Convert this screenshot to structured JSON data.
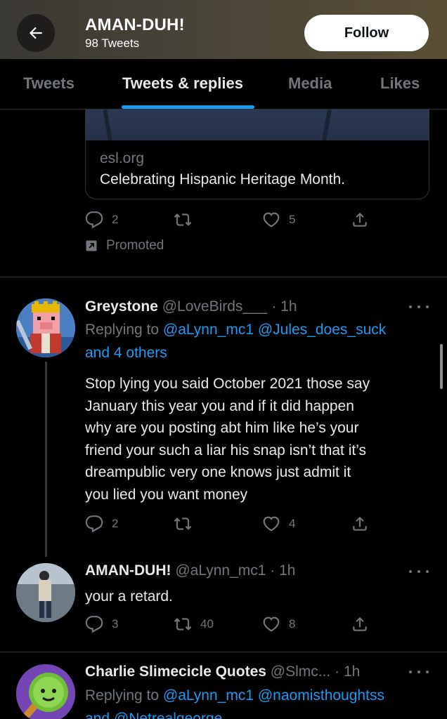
{
  "header": {
    "name": "AMAN-DUH!",
    "tweet_count": "98 Tweets",
    "follow_label": "Follow"
  },
  "tabs": [
    {
      "label": "Tweets",
      "active": false
    },
    {
      "label": "Tweets & replies",
      "active": true
    },
    {
      "label": "Media",
      "active": false
    },
    {
      "label": "Likes",
      "active": false
    }
  ],
  "promoted_card": {
    "domain": "esl.org",
    "title": "Celebrating Hispanic Heritage Month.",
    "replies": "2",
    "likes": "5",
    "promoted_label": "Promoted"
  },
  "tweets": [
    {
      "name": "Greystone",
      "handle": "@LoveBirds___",
      "time": "· 1h",
      "replying_prefix": "Replying to",
      "replying_to_1": "@aLynn_mc1",
      "replying_to_2": "@Jules_does_suck",
      "replying_to_3": "and 4 others",
      "text_lines": [
        "Stop lying you said October 2021 those say",
        "January this year you and if it did happen",
        "why are you posting abt him like he’s your",
        "friend your such a liar his snap isn’t that it’s",
        "dreampublic very one knows just admit it",
        "you lied you want money"
      ],
      "replies": "2",
      "retweets": "",
      "likes": "4"
    },
    {
      "name": "AMAN-DUH!",
      "handle": "@aLynn_mc1",
      "time": "· 1h",
      "text": "your a retard.",
      "replies": "3",
      "retweets": "40",
      "likes": "8"
    },
    {
      "name": "Charlie Slimecicle Quotes",
      "handle": "@Slmc...",
      "time": "· 1h",
      "replying_prefix": "Replying to",
      "replying_to_1": "@aLynn_mc1",
      "replying_to_2": "@naomisthoughtss",
      "replying_to_3": "and @Netrealgeorge"
    }
  ],
  "colors": {
    "accent": "#1d9bf0",
    "muted": "#71767b",
    "text": "#e7e9ea",
    "background": "#000000"
  }
}
